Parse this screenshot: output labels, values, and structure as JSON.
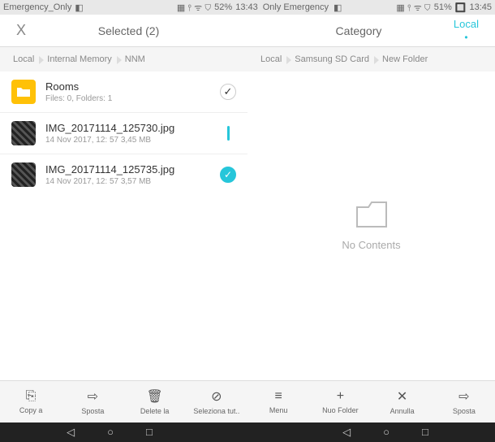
{
  "status": {
    "left1": "Emergency_Only",
    "batt1": "52%",
    "time1": "13:43",
    "midText": "Only Emergency",
    "batt2": "51%",
    "time2": "13:45"
  },
  "header": {
    "selectedTitle": "Selected (2)",
    "category": "Category",
    "local": "Local"
  },
  "breadcrumbs": {
    "left": [
      "Local",
      "Internal Memory",
      "NNM"
    ],
    "right": [
      "Local",
      "Samsung SD Card",
      "New Folder"
    ]
  },
  "items": [
    {
      "name": "Rooms",
      "meta": "Files: 0, Folders: 1",
      "type": "folder",
      "checked": false
    },
    {
      "name": "IMG_20171114_125730.jpg",
      "meta": "14 Nov 2017, 12: 57 3,45 MB",
      "type": "image",
      "checked": "partial"
    },
    {
      "name": "IMG_20171114_125735.jpg",
      "meta": "14 Nov 2017, 12: 57 3,57 MB",
      "type": "image",
      "checked": true
    }
  ],
  "empty": "No Contents",
  "bottom": {
    "left": [
      "Copy a",
      "Sposta",
      "Delete la",
      "Seleziona tut..",
      "Menu"
    ],
    "right": [
      "Nuo Folder",
      "Annulla",
      "Sposta"
    ]
  }
}
